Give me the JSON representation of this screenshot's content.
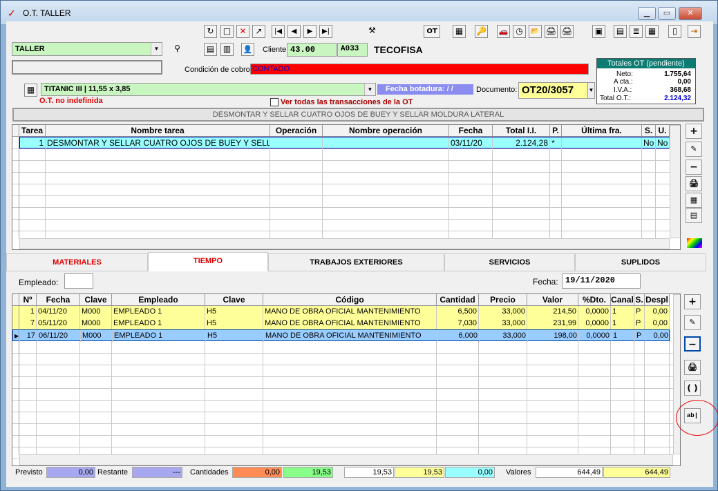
{
  "window": {
    "title": "O.T. TALLER",
    "min": "▁",
    "max": "▭",
    "close": "✕"
  },
  "toolbar": {
    "g1": [
      "↻",
      "□",
      "✕",
      "↗"
    ],
    "g2": [
      "|◀",
      "◀",
      "▶",
      "▶|"
    ],
    "tools": "⚒",
    "ot": "OT",
    "g3": [
      "▦",
      "🔑"
    ],
    "g4": [
      "🚗",
      "◷",
      "📂",
      "🖨",
      "🖨"
    ],
    "g5": [
      "▣",
      "▤",
      "≣",
      "▦"
    ],
    "g6": [
      "▯",
      "⇥"
    ]
  },
  "header": {
    "taller": "TALLER",
    "binoc": "⚲",
    "b1": "▤",
    "b2": "▥",
    "person": "👤",
    "cliente_label": "Cliente:",
    "cliente_num": "43.00",
    "cliente_code": "A033",
    "cliente_name": "TECOFISA",
    "cobro_label": "Condición de cobro:",
    "cobro_value": "CONTADO",
    "vehiculo_icon": "▦",
    "vehiculo": "TITANIC III | 11,55 x 3,85",
    "fecha_botadura": "Fecha botadura:  / /",
    "documento_label": "Documento:",
    "documento": "OT20/3057",
    "ot_status": "O.T. no indefinida",
    "ver_todas": "Ver todas las transacciones de la OT",
    "descripcion": "DESMONTAR Y SELLAR CUATRO OJOS DE BUEY Y SELLAR MOLDURA LATERAL"
  },
  "totales": {
    "title": "Totales OT (pendiente)",
    "neto_label": "Neto:",
    "neto": "1.755,64",
    "acta_label": "A cta.:",
    "acta": "0,00",
    "iva_label": "I.V.A.:",
    "iva": "368,68",
    "total_label": "Total O.T.:",
    "total": "2.124,32"
  },
  "tasks": {
    "headers": [
      "Tarea",
      "Nombre tarea",
      "Operación",
      "Nombre operación",
      "Fecha",
      "Total I.I.",
      "P.",
      "Última fra.",
      "S.",
      "U."
    ],
    "rows": [
      [
        "1",
        "DESMONTAR Y SELLAR CUATRO OJOS DE BUEY Y SELLA",
        "",
        "",
        "03/11/20",
        "2.124,28",
        "*",
        "",
        "No",
        "No"
      ]
    ]
  },
  "task_side": [
    "+",
    "✎",
    "−",
    "🖨",
    "▦",
    "▤"
  ],
  "tabs": [
    "MATERIALES",
    "TIEMPO",
    "TRABAJOS EXTERIORES",
    "SERVICIOS",
    "SUPLIDOS"
  ],
  "tiempo": {
    "empleado_label": "Empleado:",
    "empleado": "",
    "fecha_label": "Fecha:",
    "fecha": "19/11/2020",
    "headers": [
      "Nº",
      "Fecha",
      "Clave",
      "Empleado",
      "Clave",
      "Código",
      "Cantidad",
      "Precio",
      "Valor",
      "%Dto.",
      "Canal",
      "S.",
      "Despl"
    ],
    "rows": [
      [
        "1",
        "04/11/20",
        "M000",
        "EMPLEADO 1",
        "H5",
        "MANO DE OBRA OFICIAL MANTENIMIENTO",
        "6,500",
        "33,000",
        "214,50",
        "0,0000",
        "1",
        "P",
        "0,00"
      ],
      [
        "7",
        "05/11/20",
        "M000",
        "EMPLEADO 1",
        "H5",
        "MANO DE OBRA OFICIAL MANTENIMIENTO",
        "7,030",
        "33,000",
        "231,99",
        "0,0000",
        "1",
        "P",
        "0,00"
      ],
      [
        "17",
        "06/11/20",
        "M000",
        "EMPLEADO 1",
        "H5",
        "MANO DE OBRA OFICIAL MANTENIMIENTO",
        "6,000",
        "33,000",
        "198,00",
        "0,0000",
        "1",
        "P",
        "0,00"
      ]
    ]
  },
  "time_side": [
    "+",
    "✎",
    "−",
    "🖨",
    "( )",
    "ab|"
  ],
  "footer": {
    "previsto_label": "Previsto",
    "previsto": "0,00",
    "restante_label": "Restante",
    "restante": "---",
    "cantidades_label": "Cantidades",
    "c1": "0,00",
    "c2": "19,53",
    "c3": "19,53",
    "c4": "19,53",
    "c5": "0,00",
    "valores_label": "Valores",
    "v1": "644,49",
    "v2": "644,49"
  },
  "colors": {
    "green": "#c9f5c0",
    "red": "#ff0000",
    "yellow": "#ffff99",
    "cyan": "#99ffff",
    "totales_head": "#0c7b73"
  }
}
